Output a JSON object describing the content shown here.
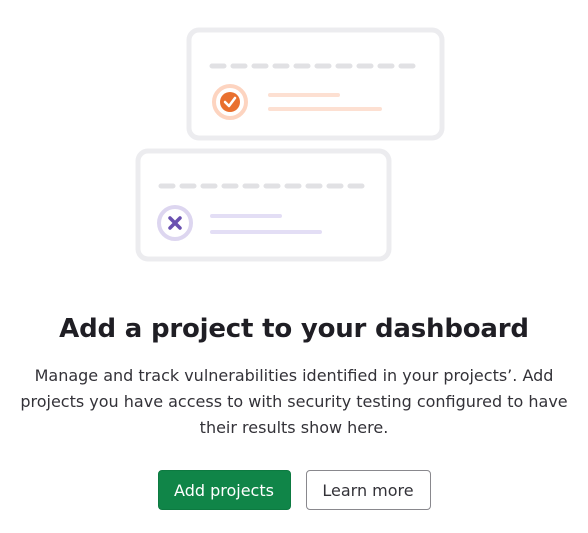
{
  "empty_state": {
    "title": "Add a project to your dashboard",
    "description": "Manage and track vulnerabilities identified in your projects’. Add projects you have access to with security testing configured to have their results show here.",
    "illustration": {
      "top_card_icon": "check-icon",
      "bottom_card_icon": "close-icon",
      "colors": {
        "card_border": "#ececef",
        "dash": "#e1e1e4",
        "success_ring": "#fdd4c0",
        "success_mark": "#e9702f",
        "success_line": "#fde0d2",
        "error_ring": "#ddd6f0",
        "error_mark": "#6a51b0",
        "error_line": "#e3def5"
      }
    }
  },
  "actions": {
    "primary_label": "Add projects",
    "secondary_label": "Learn more"
  },
  "colors": {
    "primary": "#108548",
    "text": "#333238"
  }
}
